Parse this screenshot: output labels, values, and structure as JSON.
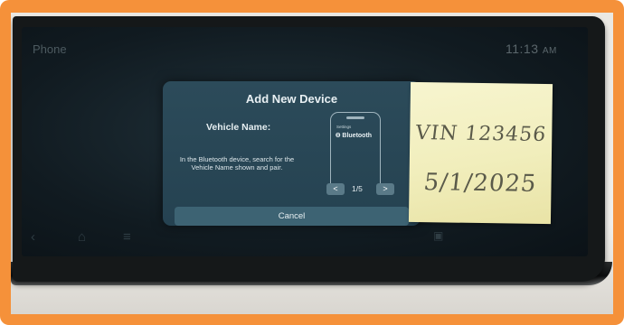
{
  "screen": {
    "app_label": "Phone",
    "clock": "11:13",
    "clock_suffix": "AM"
  },
  "dialog": {
    "title": "Add New Device",
    "vehicle_name_label": "Vehicle Name:",
    "instructions": "In the Bluetooth device, search for the Vehicle Name shown and pair.",
    "phone_screen_settings": "Settings",
    "phone_screen_bluetooth": "Bluetooth",
    "page_indicator": "1/5",
    "prev_label": "<",
    "next_label": ">",
    "cancel_label": "Cancel"
  },
  "sticky_note": {
    "line1": "VIN 123456",
    "line2": "5/1/2025"
  },
  "nav_icons": [
    "back-icon",
    "home-icon",
    "menu-icon",
    "settings-icon"
  ],
  "colors": {
    "frame_border": "#f5913a",
    "dialog_bg": "#2c4b5a",
    "cancel_button": "#3d6373",
    "sticky_note": "#f3f0c0"
  }
}
